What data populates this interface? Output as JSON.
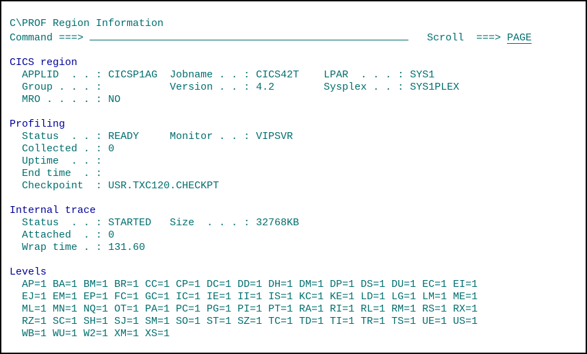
{
  "panel_title": "C\\PROF Region Information",
  "command": {
    "label": "Command ===>",
    "value": ""
  },
  "scroll": {
    "label": "Scroll  ===>",
    "value": "PAGE"
  },
  "cics_region": {
    "heading": "CICS region",
    "applid": {
      "label": "APPLID  . . :",
      "value": "CICSP1AG"
    },
    "jobname": {
      "label": "Jobname . . :",
      "value": "CICS42T"
    },
    "lpar": {
      "label": "LPAR  . . . :",
      "value": "SYS1"
    },
    "group": {
      "label": "Group . . . :",
      "value": ""
    },
    "version": {
      "label": "Version . . :",
      "value": "4.2"
    },
    "sysplex": {
      "label": "Sysplex . . :",
      "value": "SYS1PLEX"
    },
    "mro": {
      "label": "MRO . . . . :",
      "value": "NO"
    }
  },
  "profiling": {
    "heading": "Profiling",
    "status": {
      "label": "Status  . . :",
      "value": "READY"
    },
    "monitor": {
      "label": "Monitor . . :",
      "value": "VIPSVR"
    },
    "collected": {
      "label": "Collected . :",
      "value": "0"
    },
    "uptime": {
      "label": "Uptime  . . :",
      "value": ""
    },
    "end_time": {
      "label": "End time  . :",
      "value": ""
    },
    "checkpoint": {
      "label": "Checkpoint  :",
      "value": "USR.TXC120.CHECKPT"
    }
  },
  "trace": {
    "heading": "Internal trace",
    "status": {
      "label": "Status  . . :",
      "value": "STARTED"
    },
    "size": {
      "label": "Size  . . . :",
      "value": "32768KB"
    },
    "attached": {
      "label": "Attached  . :",
      "value": "0"
    },
    "wrap_time": {
      "label": "Wrap time . :",
      "value": "131.60"
    }
  },
  "levels": {
    "heading": "Levels",
    "rows": [
      "AP=1 BA=1 BM=1 BR=1 CC=1 CP=1 DC=1 DD=1 DH=1 DM=1 DP=1 DS=1 DU=1 EC=1 EI=1",
      "EJ=1 EM=1 EP=1 FC=1 GC=1 IC=1 IE=1 II=1 IS=1 KC=1 KE=1 LD=1 LG=1 LM=1 ME=1",
      "ML=1 MN=1 NQ=1 OT=1 PA=1 PC=1 PG=1 PI=1 PT=1 RA=1 RI=1 RL=1 RM=1 RS=1 RX=1",
      "RZ=1 SC=1 SH=1 SJ=1 SM=1 SO=1 ST=1 SZ=1 TC=1 TD=1 TI=1 TR=1 TS=1 UE=1 US=1",
      "WB=1 WU=1 W2=1 XM=1 XS=1"
    ]
  }
}
